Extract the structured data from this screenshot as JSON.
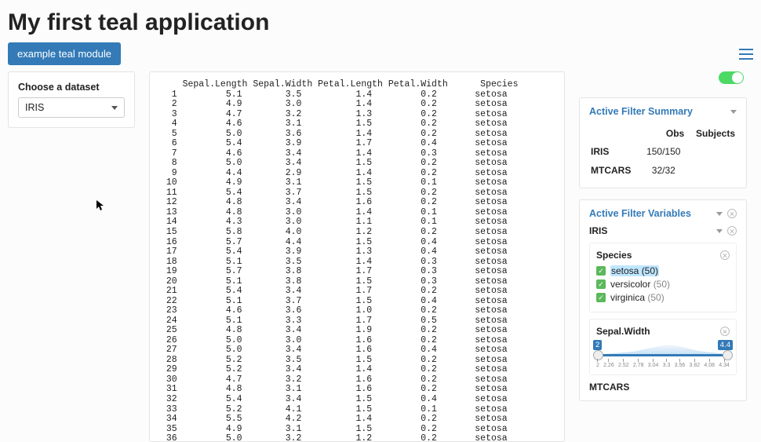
{
  "page_title": "My first teal application",
  "module_button": "example teal module",
  "dataset_select": {
    "label": "Choose a dataset",
    "value": "IRIS"
  },
  "data_headers": [
    "Sepal.Length",
    "Sepal.Width",
    "Petal.Length",
    "Petal.Width",
    "Species"
  ],
  "data_rows": [
    [
      1,
      5.1,
      3.5,
      1.4,
      0.2,
      "setosa"
    ],
    [
      2,
      4.9,
      3.0,
      1.4,
      0.2,
      "setosa"
    ],
    [
      3,
      4.7,
      3.2,
      1.3,
      0.2,
      "setosa"
    ],
    [
      4,
      4.6,
      3.1,
      1.5,
      0.2,
      "setosa"
    ],
    [
      5,
      5.0,
      3.6,
      1.4,
      0.2,
      "setosa"
    ],
    [
      6,
      5.4,
      3.9,
      1.7,
      0.4,
      "setosa"
    ],
    [
      7,
      4.6,
      3.4,
      1.4,
      0.3,
      "setosa"
    ],
    [
      8,
      5.0,
      3.4,
      1.5,
      0.2,
      "setosa"
    ],
    [
      9,
      4.4,
      2.9,
      1.4,
      0.2,
      "setosa"
    ],
    [
      10,
      4.9,
      3.1,
      1.5,
      0.1,
      "setosa"
    ],
    [
      11,
      5.4,
      3.7,
      1.5,
      0.2,
      "setosa"
    ],
    [
      12,
      4.8,
      3.4,
      1.6,
      0.2,
      "setosa"
    ],
    [
      13,
      4.8,
      3.0,
      1.4,
      0.1,
      "setosa"
    ],
    [
      14,
      4.3,
      3.0,
      1.1,
      0.1,
      "setosa"
    ],
    [
      15,
      5.8,
      4.0,
      1.2,
      0.2,
      "setosa"
    ],
    [
      16,
      5.7,
      4.4,
      1.5,
      0.4,
      "setosa"
    ],
    [
      17,
      5.4,
      3.9,
      1.3,
      0.4,
      "setosa"
    ],
    [
      18,
      5.1,
      3.5,
      1.4,
      0.3,
      "setosa"
    ],
    [
      19,
      5.7,
      3.8,
      1.7,
      0.3,
      "setosa"
    ],
    [
      20,
      5.1,
      3.8,
      1.5,
      0.3,
      "setosa"
    ],
    [
      21,
      5.4,
      3.4,
      1.7,
      0.2,
      "setosa"
    ],
    [
      22,
      5.1,
      3.7,
      1.5,
      0.4,
      "setosa"
    ],
    [
      23,
      4.6,
      3.6,
      1.0,
      0.2,
      "setosa"
    ],
    [
      24,
      5.1,
      3.3,
      1.7,
      0.5,
      "setosa"
    ],
    [
      25,
      4.8,
      3.4,
      1.9,
      0.2,
      "setosa"
    ],
    [
      26,
      5.0,
      3.0,
      1.6,
      0.2,
      "setosa"
    ],
    [
      27,
      5.0,
      3.4,
      1.6,
      0.4,
      "setosa"
    ],
    [
      28,
      5.2,
      3.5,
      1.5,
      0.2,
      "setosa"
    ],
    [
      29,
      5.2,
      3.4,
      1.4,
      0.2,
      "setosa"
    ],
    [
      30,
      4.7,
      3.2,
      1.6,
      0.2,
      "setosa"
    ],
    [
      31,
      4.8,
      3.1,
      1.6,
      0.2,
      "setosa"
    ],
    [
      32,
      5.4,
      3.4,
      1.5,
      0.4,
      "setosa"
    ],
    [
      33,
      5.2,
      4.1,
      1.5,
      0.1,
      "setosa"
    ],
    [
      34,
      5.5,
      4.2,
      1.4,
      0.2,
      "setosa"
    ],
    [
      35,
      4.9,
      3.1,
      1.5,
      0.2,
      "setosa"
    ],
    [
      36,
      5.0,
      3.2,
      1.2,
      0.2,
      "setosa"
    ]
  ],
  "filter_summary": {
    "title": "Active Filter Summary",
    "columns": [
      "",
      "Obs",
      "Subjects"
    ],
    "rows": [
      {
        "name": "IRIS",
        "obs": "150/150",
        "subjects": ""
      },
      {
        "name": "MTCARS",
        "obs": "32/32",
        "subjects": ""
      }
    ]
  },
  "filter_vars": {
    "title": "Active Filter Variables",
    "dataset": "IRIS",
    "species": {
      "label": "Species",
      "options": [
        {
          "name": "setosa",
          "count": 50,
          "checked": true,
          "highlight": true
        },
        {
          "name": "versicolor",
          "count": 50,
          "checked": true,
          "highlight": false
        },
        {
          "name": "virginica",
          "count": 50,
          "checked": true,
          "highlight": false
        }
      ]
    },
    "sepal_width": {
      "label": "Sepal.Width",
      "min": 2,
      "max": 4.4,
      "ticks": [
        "2",
        "2.26",
        "2.52",
        "2.78",
        "3.04",
        "3.3",
        "3.56",
        "3.82",
        "4.08",
        "4.34"
      ]
    },
    "second_dataset": "MTCARS"
  }
}
